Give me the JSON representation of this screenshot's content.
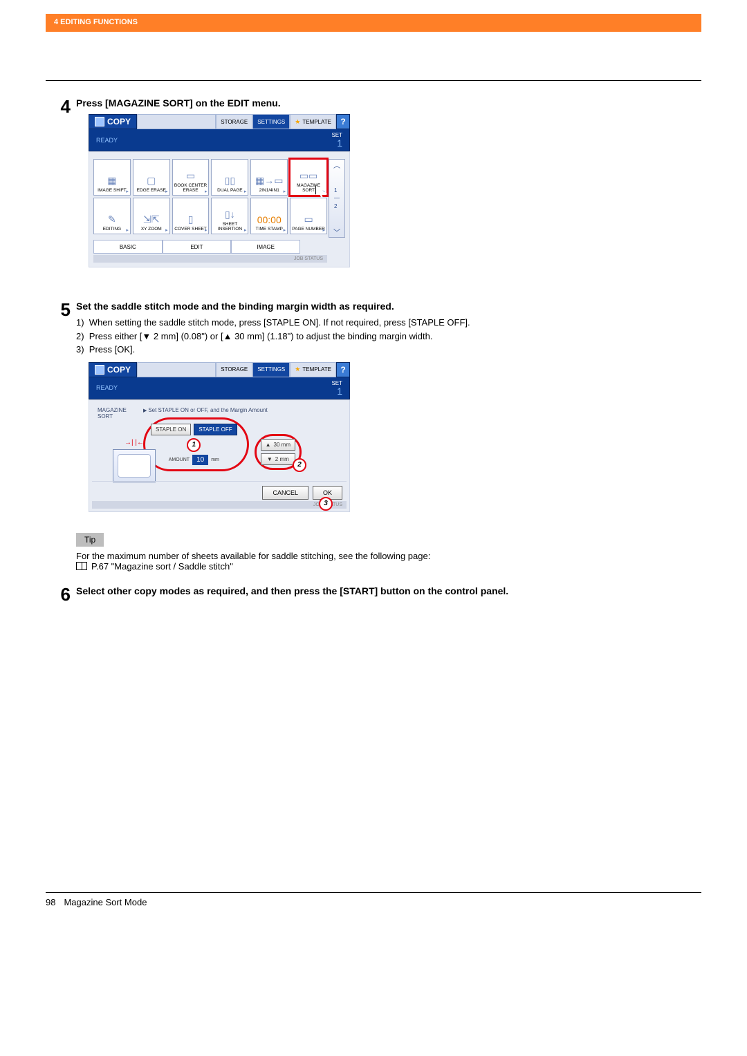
{
  "header": {
    "section": "4 EDITING FUNCTIONS"
  },
  "steps": {
    "s4": {
      "num": "4",
      "title": "Press [MAGAZINE SORT] on the EDIT menu."
    },
    "s5": {
      "num": "5",
      "title": "Set the saddle stitch mode and the binding margin width as required.",
      "line1_prefix": "1)",
      "line1": "When setting the saddle stitch mode, press [STAPLE ON]. If not required, press [STAPLE OFF].",
      "line2_prefix": "2)",
      "line2a": "Press either [",
      "line2b": " 2 mm] (0.08\") or [",
      "line2c": " 30 mm] (1.18\") to adjust the binding margin width.",
      "line3_prefix": "3)",
      "line3": "Press [OK]."
    },
    "s6": {
      "num": "6",
      "title": "Select other copy modes as required, and then press the [START] button on the control panel."
    }
  },
  "tip": {
    "label": "Tip",
    "line1": "For the maximum number of sheets available for saddle stitching, see the following page:",
    "ref": "P.67 \"Magazine sort / Saddle stitch\""
  },
  "panel1": {
    "copy": "COPY",
    "tabs": {
      "storage": "STORAGE",
      "settings": "SETTINGS",
      "template": "TEMPLATE"
    },
    "help": "?",
    "ready": "READY",
    "set_label": "SET",
    "set_num": "1",
    "tiles": [
      "IMAGE\nSHIFT",
      "EDGE\nERASE",
      "BOOK CENTER\nERASE",
      "DUAL PAGE",
      "2IN1/4IN1",
      "MAGAZINE\nSORT",
      "EDITING",
      "XY ZOOM",
      "COVER\nSHEET",
      "SHEET\nINSERTION",
      "TIME\nSTAMP",
      "PAGE\nNUMBER"
    ],
    "tile_icons": [
      "▦",
      "▢",
      "▭",
      "▯▯",
      "▦→▭",
      "▭▭",
      "✎",
      "⇲⇱",
      "▯",
      "▯↓",
      "00:00",
      "▭"
    ],
    "page_up": "1",
    "page_dn": "2",
    "bottom_tabs": {
      "basic": "BASIC",
      "edit": "EDIT",
      "image": "IMAGE"
    },
    "jobstatus": "JOB STATUS"
  },
  "panel2": {
    "copy": "COPY",
    "tabs": {
      "storage": "STORAGE",
      "settings": "SETTINGS",
      "template": "TEMPLATE"
    },
    "help": "?",
    "ready": "READY",
    "set_label": "SET",
    "set_num": "1",
    "left_label": "MAGAZINE\nSORT",
    "instr": "Set STAPLE ON or OFF, and the Margin Amount",
    "staple_on": "STAPLE ON",
    "staple_off": "STAPLE OFF",
    "amount_label": "AMOUNT",
    "amount_value": "10",
    "amount_unit": "mm",
    "btn_up": "30 mm",
    "btn_dn": "2 mm",
    "ring1": "1",
    "ring2": "2",
    "ring3": "3",
    "cancel": "CANCEL",
    "ok": "OK",
    "jobstatus": "JOB STATUS"
  },
  "footer": {
    "page": "98",
    "title": "Magazine Sort Mode"
  }
}
